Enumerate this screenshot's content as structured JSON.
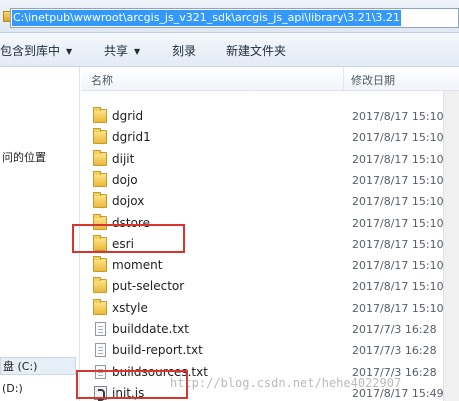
{
  "address_bar": {
    "path": "C:\\inetpub\\wwwroot\\arcgis_js_v321_sdk\\arcgis_js_api\\library\\3.21\\3.21"
  },
  "toolbar": {
    "include_in_library": "包含到库中",
    "share": "共享",
    "burn": "刻录",
    "new_folder": "新建文件夹"
  },
  "nav_pane": {
    "recent_places": "问的位置",
    "drive_c": "盘 (C:)",
    "drive_d": "(D:)"
  },
  "columns": {
    "name": "名称",
    "date_modified": "修改日期"
  },
  "files": [
    {
      "name": "dgrid",
      "type": "folder",
      "date": "2017/8/17 15:10"
    },
    {
      "name": "dgrid1",
      "type": "folder",
      "date": "2017/8/17 15:10"
    },
    {
      "name": "dijit",
      "type": "folder",
      "date": "2017/8/17 15:10"
    },
    {
      "name": "dojo",
      "type": "folder",
      "date": "2017/8/17 15:10"
    },
    {
      "name": "dojox",
      "type": "folder",
      "date": "2017/8/17 15:10"
    },
    {
      "name": "dstore",
      "type": "folder",
      "date": "2017/8/17 15:10"
    },
    {
      "name": "esri",
      "type": "folder",
      "date": "2017/8/17 15:10"
    },
    {
      "name": "moment",
      "type": "folder",
      "date": "2017/8/17 15:10"
    },
    {
      "name": "put-selector",
      "type": "folder",
      "date": "2017/8/17 15:10"
    },
    {
      "name": "xstyle",
      "type": "folder",
      "date": "2017/8/17 15:10"
    },
    {
      "name": "builddate.txt",
      "type": "text",
      "date": "2017/7/3 16:28"
    },
    {
      "name": "build-report.txt",
      "type": "text",
      "date": "2017/7/3 16:28"
    },
    {
      "name": "buildsources.txt",
      "type": "text",
      "date": "2017/7/3 16:28"
    },
    {
      "name": "init.js",
      "type": "js",
      "date": "2017/8/17 15:49"
    }
  ],
  "watermark": "http://blog.csdn.net/hehe4022907",
  "colors": {
    "highlight": "#d9342e",
    "selection": "#3399ff"
  }
}
